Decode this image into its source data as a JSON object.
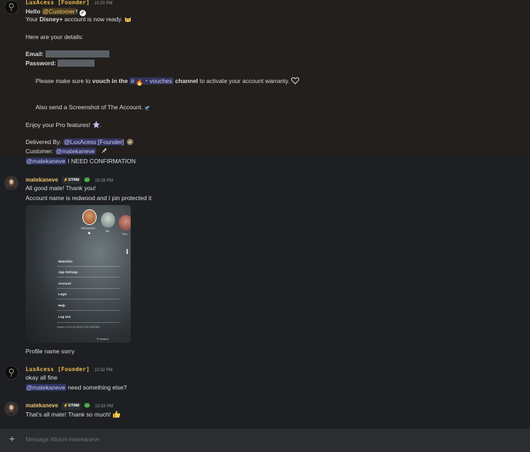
{
  "messages": {
    "m1": {
      "author": "LuxAcess [Founder]",
      "time": "10:20 PM",
      "hello": "Hello",
      "customer_mention": "@Customer",
      "your_pre": "Your",
      "service": "Disney+",
      "ready": "account is now ready.",
      "details": "Here are your details:",
      "email_label": "Email:",
      "password_label": "Password:",
      "vouch_pre": "Please make sure to",
      "vouch_bold": "vouch in the",
      "channel_hash": "#",
      "channel_name": "・vouches",
      "channel_word": "channel",
      "vouch_post": "to activate your account warranty.",
      "screenshot": "Also send a Screenshot of The Account.",
      "enjoy": "Enjoy your Pro features!",
      "delivered_label": "Delivered By:",
      "delivered_mention": "@LuxAcess [Founder]",
      "customer_label": "Customer:",
      "customer_value": "@matekaneve",
      "confirm_mention": "@matekaneve",
      "confirm_text": "I NEED CONFIRMATION"
    },
    "m2": {
      "author": "matekaneve",
      "badge": "STRM",
      "time": "10:28 PM",
      "line1": "All good mate! Thank you!",
      "line2": "Account name is redwood and I pin protected it",
      "line3": "Profile name sorry"
    },
    "attachment": {
      "profiles": [
        "REDWOOD",
        "Tiki",
        "Gus"
      ],
      "menu": [
        "Watchlist",
        "App Settings",
        "Account",
        "Legal",
        "Help",
        "Log Out"
      ],
      "version": "Version: 4.20.2 rc1 (2025 1 28) (1234FMS)",
      "search": "Search"
    },
    "m3": {
      "author": "LuxAcess [Founder]",
      "time": "10:32 PM",
      "line1": "okay all fine",
      "mention": "@matekaneve",
      "line2": "need something else?"
    },
    "m4": {
      "author": "matekaneve",
      "badge": "STRM",
      "time": "10:33 PM",
      "line1": "That's all mate! Thank so much!"
    }
  },
  "input": {
    "placeholder": "Message #ticket-matekaneve"
  }
}
